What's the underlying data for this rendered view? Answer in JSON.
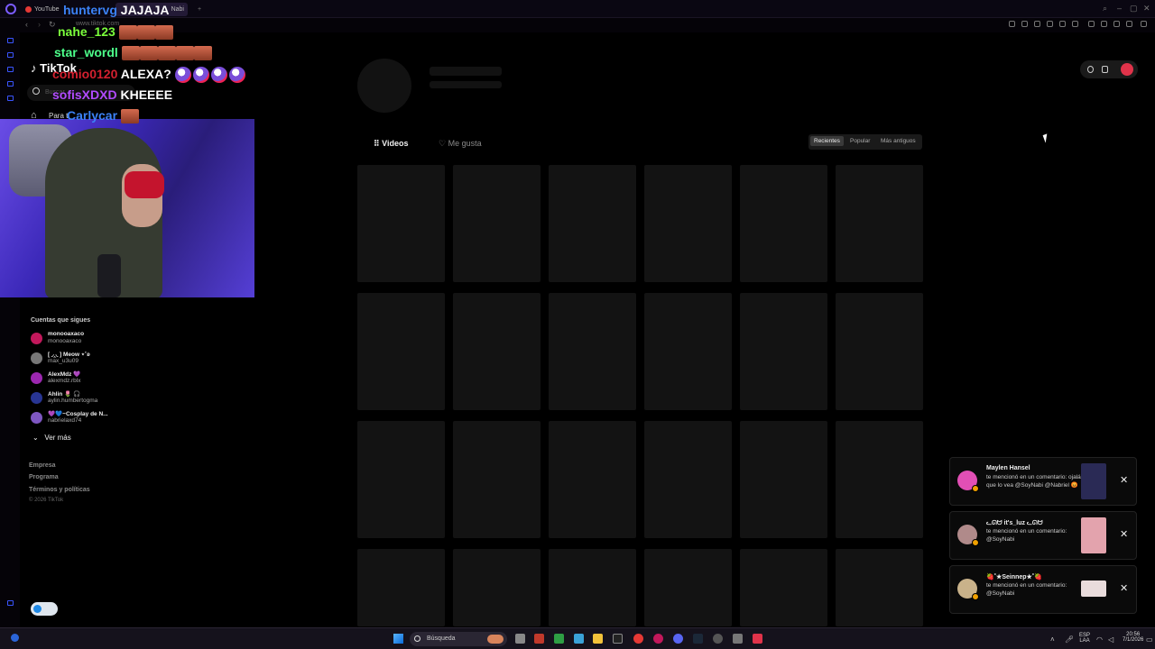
{
  "browser": {
    "tabs": [
      {
        "label": "YouTube"
      },
      {
        "label": "Nabi"
      }
    ],
    "url": "www.tiktok.com"
  },
  "chat": [
    {
      "user": "huntervg",
      "msg": "JAJAJA",
      "user_color": "#3b82f6"
    },
    {
      "user": "nahe_123",
      "msg": "",
      "user_color": "#7bff3b"
    },
    {
      "user": "star_wordl",
      "msg": "",
      "user_color": "#4cff8a"
    },
    {
      "user": "comio0120",
      "msg": "ALEXA?",
      "user_color": "#d4202f"
    },
    {
      "user": "sofisXDXD",
      "msg": "KHEEEE",
      "user_color": "#b14bff"
    },
    {
      "user": "Carlycar",
      "msg": "",
      "user_color": "#3b82f6"
    }
  ],
  "tiktok": {
    "logo": "TikTok",
    "search_placeholder": "Buscar",
    "home_label": "Para ti",
    "following_title": "Cuentas que sigues",
    "accounts": [
      {
        "name": "monooaxaco",
        "handle": "monooaxaco",
        "color": "#c2185b"
      },
      {
        "name": "[ ◞‸◟ ] Meow ⋆˚ʚ",
        "handle": "max_u3u09",
        "color": "#777"
      },
      {
        "name": "AlexMdz 💜",
        "handle": "alexmdz.rblx",
        "color": "#9c27b0"
      },
      {
        "name": "Ahlin 🌷 🎧",
        "handle": "aylin.humbertogma",
        "color": "#283593"
      },
      {
        "name": "💜💙~Cosplay de N...",
        "handle": "nabrielaxd74",
        "color": "#7e57c2"
      }
    ],
    "see_more": "Ver más",
    "footer": [
      "Empresa",
      "Programa",
      "Términos y políticas"
    ],
    "copyright": "© 2026 TikTok"
  },
  "profile": {
    "tab_videos": "Videos",
    "tab_likes": "Me gusta",
    "sort": [
      "Recientes",
      "Popular",
      "Más antiguos"
    ],
    "sort_active": "Recientes"
  },
  "notifications": [
    {
      "title": "Maylen Hansel",
      "body": "te mencionó en un comentario: ojalá que lo vea @SoyNabi @Nabriel 😡",
      "avatar_color": "#e24fb5",
      "thumb_color": "#2a2a55"
    },
    {
      "title": "ᓚᘏᗢ it's_luz ᓚᘏᗢ",
      "body": "te mencionó en un comentario: @SoyNabi",
      "avatar_color": "#b08a8a",
      "thumb_color": "#e3a3ad"
    },
    {
      "title": "🍓˚★Seinnep★˚🍓",
      "body": "te mencionó en un comentario: @SoyNabi",
      "avatar_color": "#c9b28a",
      "thumb_color": "#e9dcdc"
    }
  ],
  "taskbar": {
    "search": "Búsqueda",
    "lang_top": "ESP",
    "lang_bottom": "LAA",
    "time": "20:56",
    "date": "7/1/2026"
  }
}
